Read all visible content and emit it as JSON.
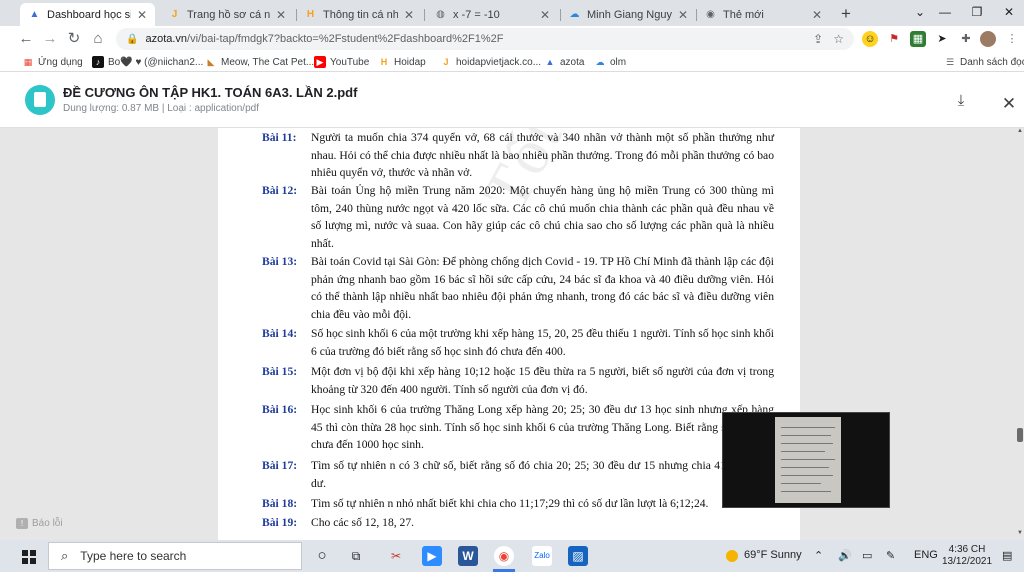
{
  "tabs": [
    {
      "title": "Dashboard học sinh",
      "icon": "azota-icon",
      "active": true
    },
    {
      "title": "Trang hồ sơ cá nhân - ",
      "icon": "hoidap-icon",
      "active": false
    },
    {
      "title": "Thông tin cá nhân",
      "icon": "hoidap-icon",
      "active": false
    },
    {
      "title": "x -7 = -10",
      "icon": "web-icon",
      "active": false
    },
    {
      "title": "Minh Giang Nguyễn - ",
      "icon": "azota-icon",
      "active": false
    },
    {
      "title": "Thẻ mới",
      "icon": "chrome-icon",
      "active": false
    }
  ],
  "toolbar": {
    "url_domain": "azota.vn",
    "url_path": "/vi/bai-tap/fmdgk7?backto=%2Fstudent%2Fdashboard%2F1%2F"
  },
  "bookmarks": {
    "items": [
      "Ứng dụng",
      "Bo🖤 ♥ (@niichan2...",
      "Meow, The Cat Pet...",
      "YouTube",
      "Hoidap",
      "hoidapvietjack.co...",
      "azota",
      "olm"
    ],
    "reading_list": "Danh sách đọc"
  },
  "pdf": {
    "title": "ĐỀ CƯƠNG ÔN TẬP HK1. TOÁN 6A3. LẦN 2.pdf",
    "meta": "Dung lượng: 0.87 MB | Loại : application/pdf"
  },
  "problems": [
    {
      "label": "Bài 11:",
      "text": "Người ta muốn chia 374 quyển vở, 68 cái thước và 340 nhãn vở thành một số phần thưởng như nhau. Hỏi có thể chia được nhiều nhất là bao nhiêu phần thưởng. Trong đó mỗi phần thưởng có bao nhiêu quyển vở, thước và nhãn vở."
    },
    {
      "label": "Bài 12:",
      "text": "Bài toán Ủng hộ miền Trung năm 2020: Một chuyến hàng ủng hộ miền Trung có 300 thùng mì tôm, 240 thùng nước ngọt và 420 lốc sữa. Các cô chú muốn chia thành các phần quà đều nhau về số lượng mì, nước và suaa. Con hãy giúp các cô chú chia sao cho số lượng các phần quà là nhiều nhất."
    },
    {
      "label": "Bài 13:",
      "text": "Bài toán Covid tại Sài Gòn: Để phòng chống dịch Covid - 19. TP Hồ Chí Minh đã thành lập các đội phản ứng nhanh bao gồm 16 bác sĩ hồi sức cấp cứu, 24 bác sĩ đa khoa và 40 điều dưỡng viên. Hỏi có thể thành lập nhiều nhất bao nhiêu đội phản ứng nhanh, trong đó các bác sĩ và điều dưỡng viên chia đều vào mỗi đội."
    },
    {
      "label": "Bài 14:",
      "text": "Số học sinh khối 6 của một trường khi xếp hàng 15, 20, 25 đều thiếu 1 người. Tính số học sinh khối 6 của trường đó biết rằng số học sinh đó chưa đến 400."
    },
    {
      "label": "Bài 15:",
      "text": "Một đơn vị bộ đội khi xếp hàng 10;12 hoặc 15 đều thừa ra 5 người, biết số người của đơn vị trong khoảng từ 320 đến 400 người. Tính số người của đơn vị đó."
    },
    {
      "label": "Bài 16:",
      "text": "Học sinh khối 6 của trường Thăng Long xếp hàng 20; 25; 30 đều dư 13 học sinh nhưng xếp hàng 45 thì còn thừa 28 học sinh. Tính số học sinh khối 6 của trường Thăng Long. Biết rằng số học sinh chưa đến 1000 học sinh."
    },
    {
      "label": "Bài 17:",
      "text": "Tìm số tự nhiên n có 3 chữ số, biết rằng số đó chia 20; 25; 30 đều dư 15 nhưng chia 41 thì không dư."
    },
    {
      "label": "Bài 18:",
      "text": "Tìm số tự nhiên n nhỏ nhất biết khi chia cho 11;17;29 thì có số dư lần lượt là 6;12;24."
    },
    {
      "label": "Bài 19:",
      "text": "Cho các số 12, 18, 27."
    }
  ],
  "watermark": "Tốt - Ba Tốt - ĐIỂM ĐỐ",
  "report": "Báo lỗi",
  "taskbar": {
    "search_placeholder": "Type here to search",
    "weather": "69°F  Sunny",
    "language": "ENG",
    "time": "4:36 CH",
    "date": "13/12/2021"
  },
  "colors": {
    "problem_label": "#1f3c99",
    "brand_teal": "#2ec5c9",
    "taskbar_bg": "#dfe4ea"
  }
}
